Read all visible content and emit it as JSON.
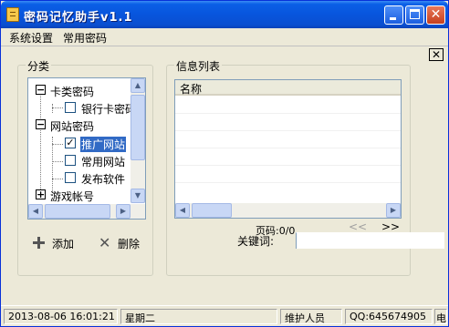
{
  "window": {
    "title": "密码记忆助手v1.1"
  },
  "menu": {
    "items": [
      "系统设置",
      "常用密码"
    ]
  },
  "category": {
    "label": "分类",
    "tree": [
      {
        "label": "卡类密码",
        "expander": "−"
      },
      {
        "label": "银行卡密码",
        "checked": false
      },
      {
        "label": "网站密码",
        "expander": "−"
      },
      {
        "label": "推广网站",
        "checked": true,
        "selected": true
      },
      {
        "label": "常用网站",
        "checked": false
      },
      {
        "label": "发布软件",
        "checked": false
      },
      {
        "label": "游戏帐号",
        "expander": "+"
      }
    ]
  },
  "actions": {
    "add": "添加",
    "delete": "删除"
  },
  "info": {
    "label": "信息列表",
    "column": "名称",
    "pager": "页码:0/0",
    "prev": "<<",
    "next": ">>",
    "keyword": "关键词:"
  },
  "status": {
    "datetime": "2013-08-06  16:01:21",
    "weekday": "星期二",
    "maintainer": "维护人员",
    "qq": "QQ:645674905",
    "tail": "电"
  }
}
